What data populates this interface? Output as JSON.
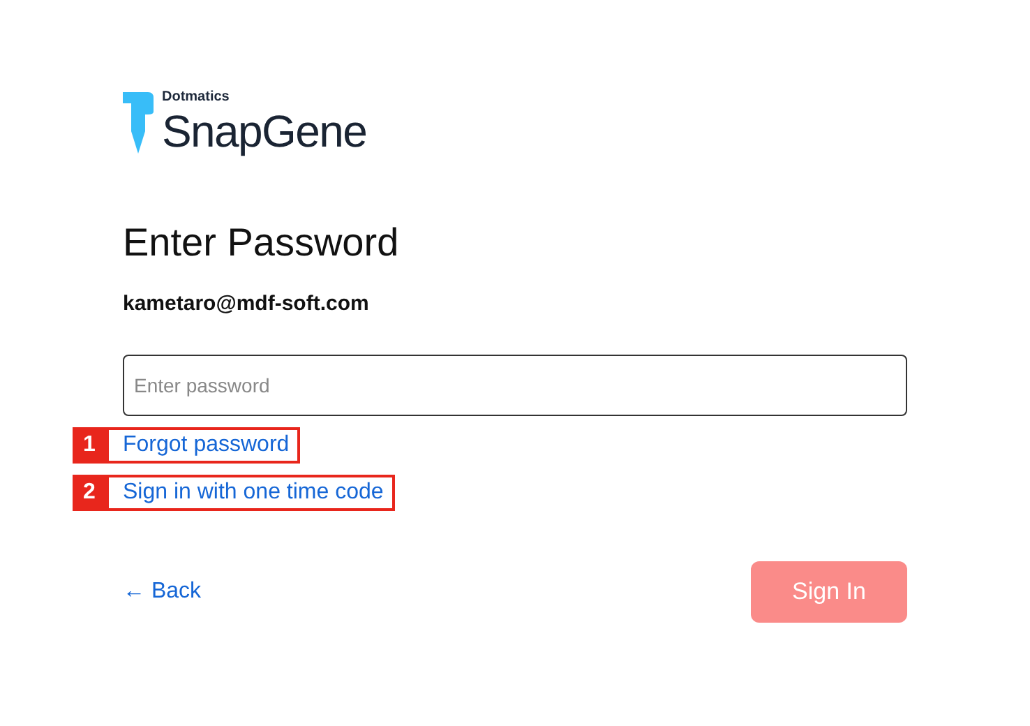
{
  "logo": {
    "company": "Dotmatics",
    "product": "SnapGene"
  },
  "title": "Enter Password",
  "email": "kametaro@mdf-soft.com",
  "password_field": {
    "placeholder": "Enter password"
  },
  "links": [
    {
      "label": "Forgot password",
      "marker": "1"
    },
    {
      "label": "Sign in with one time code",
      "marker": "2"
    }
  ],
  "back": {
    "arrow": "←",
    "label": "Back"
  },
  "sign_in": {
    "label": "Sign In",
    "disabled": true
  }
}
